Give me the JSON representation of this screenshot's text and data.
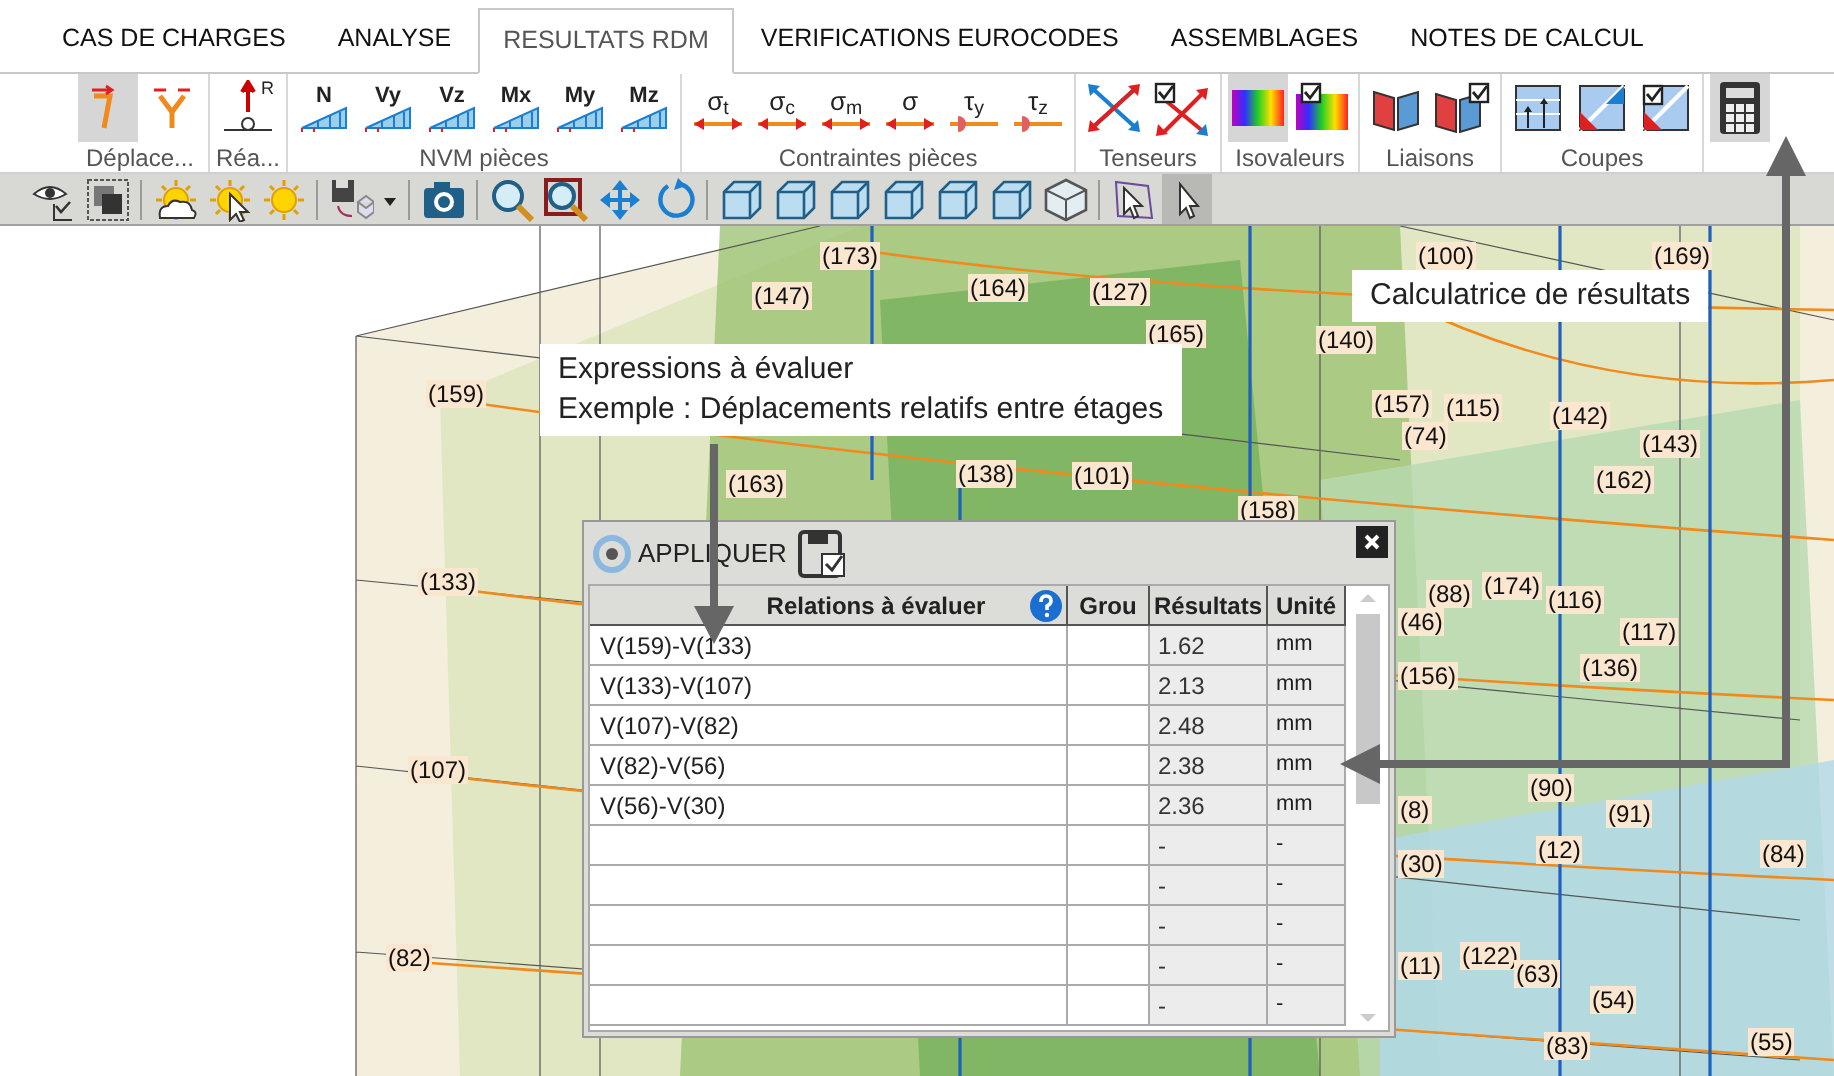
{
  "tabs": [
    {
      "label": "CAS DE CHARGES",
      "selected": false
    },
    {
      "label": "ANALYSE",
      "selected": false
    },
    {
      "label": "RESULTATS RDM",
      "selected": true
    },
    {
      "label": "VERIFICATIONS EUROCODES",
      "selected": false
    },
    {
      "label": "ASSEMBLAGES",
      "selected": false
    },
    {
      "label": "NOTES DE CALCUL",
      "selected": false
    }
  ],
  "ribbon_groups": [
    {
      "label": "Déplace...",
      "buttons": [
        {
          "kind": "displacement",
          "selected": true
        },
        {
          "kind": "displacement-split",
          "selected": false
        }
      ]
    },
    {
      "label": "Réa...",
      "buttons": [
        {
          "kind": "reaction",
          "text": "R",
          "selected": false
        }
      ]
    },
    {
      "label": "NVM pièces",
      "buttons": [
        {
          "kind": "diagram",
          "text": "N",
          "selected": false
        },
        {
          "kind": "diagram",
          "text": "Vy",
          "selected": false
        },
        {
          "kind": "diagram",
          "text": "Vz",
          "selected": false
        },
        {
          "kind": "diagram",
          "text": "Mx",
          "selected": false
        },
        {
          "kind": "diagram",
          "text": "My",
          "selected": false
        },
        {
          "kind": "diagram",
          "text": "Mz",
          "selected": false
        }
      ]
    },
    {
      "label": "Contraintes pièces",
      "buttons": [
        {
          "kind": "stress",
          "text": "σ$_{t}$",
          "selected": false
        },
        {
          "kind": "stress",
          "text": "σ$_{c}$",
          "selected": false
        },
        {
          "kind": "stress",
          "text": "σ$_{m}$",
          "selected": false
        },
        {
          "kind": "stress",
          "text": "σ",
          "selected": false
        },
        {
          "kind": "shear",
          "text": "τ$_{y}$",
          "selected": false
        },
        {
          "kind": "shear",
          "text": "τ$_{z}$",
          "selected": false
        }
      ]
    },
    {
      "label": "Tenseurs",
      "buttons": [
        {
          "kind": "tensor",
          "selected": false
        },
        {
          "kind": "tensor-list",
          "selected": false
        }
      ]
    },
    {
      "label": "Isovaleurs",
      "buttons": [
        {
          "kind": "iso",
          "selected": true
        },
        {
          "kind": "iso-list",
          "selected": false
        }
      ]
    },
    {
      "label": "Liaisons",
      "buttons": [
        {
          "kind": "link",
          "selected": false
        },
        {
          "kind": "link-list",
          "selected": false
        }
      ]
    },
    {
      "label": "Coupes",
      "buttons": [
        {
          "kind": "cut",
          "selected": false
        },
        {
          "kind": "cut-diagonal",
          "selected": false
        },
        {
          "kind": "cut-list",
          "selected": false
        }
      ]
    },
    {
      "buttons": [
        {
          "kind": "calculator",
          "selected": true
        }
      ]
    }
  ],
  "toolbar": [
    {
      "kind": "eye",
      "selected": false
    },
    {
      "kind": "layers",
      "selected": false
    },
    {
      "kind": "sep"
    },
    {
      "kind": "cloud-sun",
      "selected": false
    },
    {
      "kind": "sun-cursor",
      "selected": false
    },
    {
      "kind": "sun",
      "selected": false
    },
    {
      "kind": "sep"
    },
    {
      "kind": "save-view",
      "selected": false
    },
    {
      "kind": "caret",
      "selected": false
    },
    {
      "kind": "sep"
    },
    {
      "kind": "camera",
      "selected": false
    },
    {
      "kind": "sep"
    },
    {
      "kind": "zoom",
      "selected": false
    },
    {
      "kind": "zoom-frame",
      "selected": false
    },
    {
      "kind": "pan",
      "selected": false
    },
    {
      "kind": "rotate",
      "selected": false
    },
    {
      "kind": "sep"
    },
    {
      "kind": "cube",
      "selected": false
    },
    {
      "kind": "cube",
      "selected": false
    },
    {
      "kind": "cube",
      "selected": false
    },
    {
      "kind": "cube",
      "selected": false
    },
    {
      "kind": "cube",
      "selected": false
    },
    {
      "kind": "cube",
      "selected": false
    },
    {
      "kind": "cube-iso",
      "selected": false
    },
    {
      "kind": "sep"
    },
    {
      "kind": "select-frame",
      "selected": false
    },
    {
      "kind": "cursor",
      "selected": true
    }
  ],
  "node_labels": [
    "(173)",
    "(147)",
    "(164)",
    "(127)",
    "(165)",
    "(140)",
    "(100)",
    "(169)",
    "(159)",
    "(157)",
    "(115)",
    "(74)",
    "(142)",
    "(143)",
    "(163)",
    "(138)",
    "(101)",
    "(162)",
    "(133)",
    "(158)",
    "(88)",
    "(174)",
    "(116)",
    "(46)",
    "(117)",
    "(156)",
    "(136)",
    "(107)",
    "(90)",
    "(91)",
    "(8)",
    "(30)",
    "(12)",
    "(84)",
    "(82)",
    "(11)",
    "(122)",
    "(63)",
    "(54)",
    "(83)",
    "(55)"
  ],
  "callouts": [
    {
      "lines": [
        "Calculatrice de résultats"
      ]
    },
    {
      "lines": [
        "Expressions à évaluer",
        "Exemple : Déplacements relatifs entre étages"
      ]
    }
  ],
  "dialog": {
    "apply_button": "APPLIQUER",
    "columns": [
      "Relations à évaluer",
      "Grou",
      "Résultats",
      "Unité"
    ],
    "rows": [
      {
        "expression": "V(159)-V(133)",
        "result": "1.62",
        "unit": "mm"
      },
      {
        "expression": "V(133)-V(107)",
        "result": "2.13",
        "unit": "mm"
      },
      {
        "expression": "V(107)-V(82)",
        "result": "2.48",
        "unit": "mm"
      },
      {
        "expression": "V(82)-V(56)",
        "result": "2.38",
        "unit": "mm"
      },
      {
        "expression": "V(56)-V(30)",
        "result": "2.36",
        "unit": "mm"
      },
      {
        "result": "-",
        "unit": "-"
      },
      {
        "result": "-",
        "unit": "-"
      },
      {
        "result": "-",
        "unit": "-"
      },
      {
        "result": "-",
        "unit": "-"
      },
      {
        "result": "-",
        "unit": "-"
      }
    ]
  }
}
